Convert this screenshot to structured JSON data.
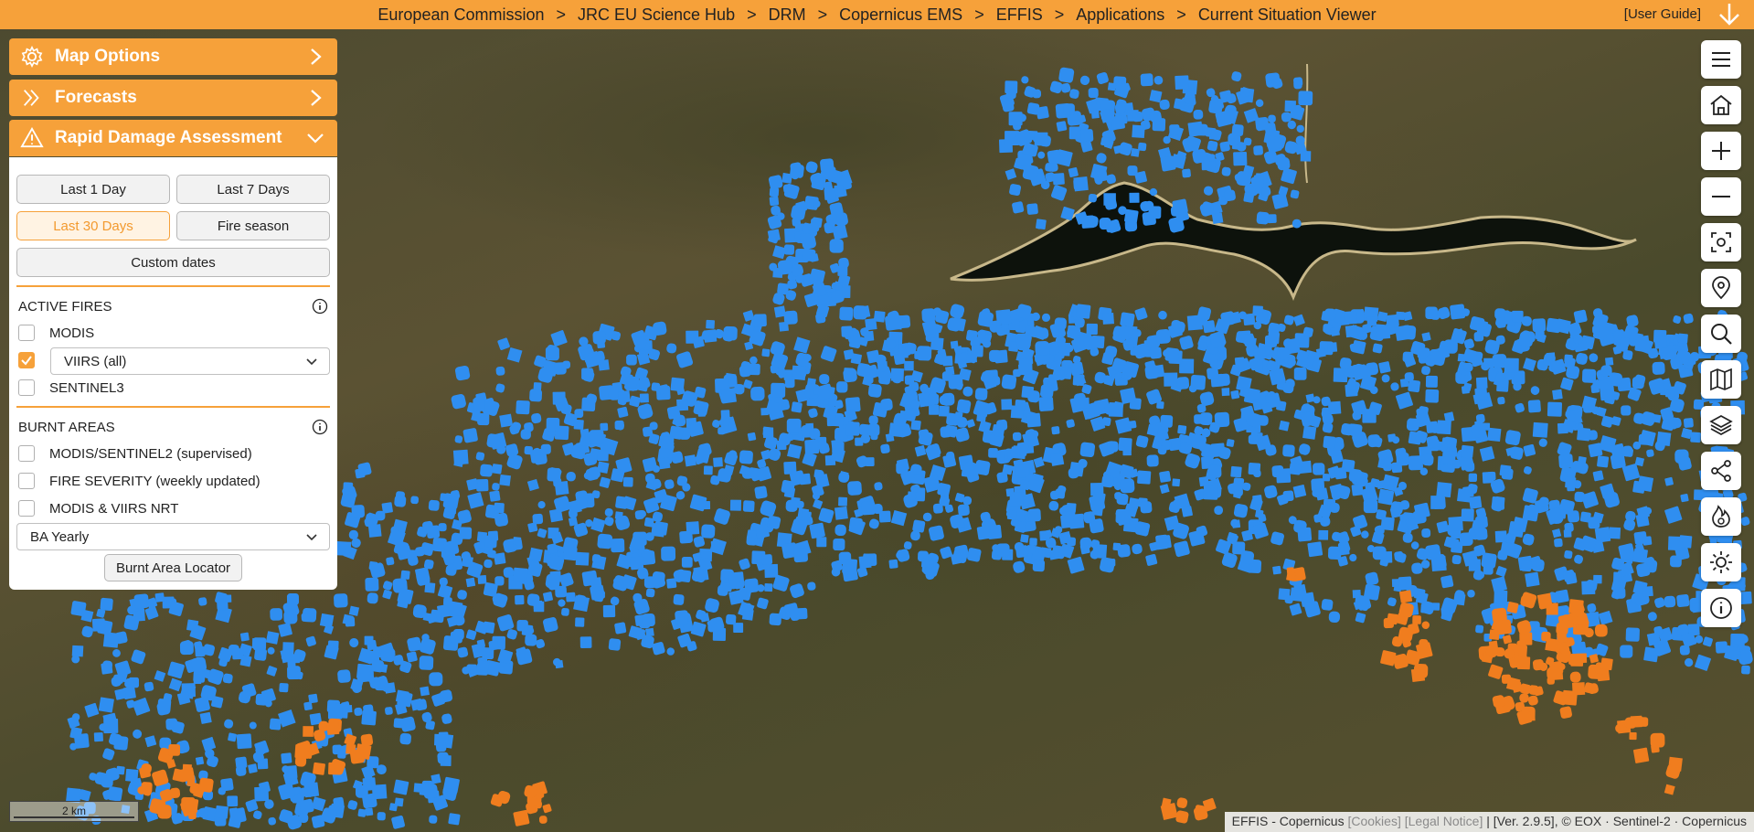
{
  "topbar": {
    "breadcrumb": [
      "European Commission",
      "JRC EU Science Hub",
      "DRM",
      "Copernicus EMS",
      "EFFIS",
      "Applications",
      "Current Situation Viewer"
    ],
    "separator": ">",
    "user_guide": "[User Guide]"
  },
  "panel": {
    "map_options": "Map Options",
    "forecasts": "Forecasts",
    "rapid_damage": "Rapid Damage Assessment",
    "buttons": {
      "last_1_day": "Last 1 Day",
      "last_7_days": "Last 7 Days",
      "last_30_days": "Last 30 Days",
      "fire_season": "Fire season",
      "custom_dates": "Custom dates"
    },
    "active_period": "Last 30 Days",
    "active_fires": {
      "title": "ACTIVE FIRES",
      "modis": {
        "label": "MODIS",
        "checked": false
      },
      "viirs": {
        "label": "VIIRS",
        "checked": true,
        "select_value": "VIIRS (all)"
      },
      "sentinel3": {
        "label": "SENTINEL3",
        "checked": false
      }
    },
    "burnt_areas": {
      "title": "BURNT AREAS",
      "items": [
        {
          "label": "MODIS/SENTINEL2 (supervised)",
          "checked": false
        },
        {
          "label": "FIRE SEVERITY (weekly updated)",
          "checked": false
        },
        {
          "label": "MODIS & VIIRS NRT",
          "checked": false
        }
      ],
      "select_value": "BA Yearly",
      "locator_button": "Burnt Area Locator"
    }
  },
  "toolbar": [
    "menu-icon",
    "home-icon",
    "zoom-in-icon",
    "zoom-out-icon",
    "locate-icon",
    "map-pin-icon",
    "search-icon",
    "map-icon",
    "layers-icon",
    "share-icon",
    "fire-icon",
    "brightness-icon",
    "info-icon"
  ],
  "scalebar": {
    "label": "2 km"
  },
  "attribution": {
    "prefix": "EFFIS - Copernicus",
    "cookies": "[Cookies]",
    "legal": "[Legal Notice]",
    "suffix": "| [Ver. 2.9.5], © EOX · Sentinel-2 · Copernicus"
  },
  "colors": {
    "accent": "#f6a13a",
    "viirs_hotspot": "#2f8ef0",
    "modis_hotspot": "#f07d1e"
  }
}
